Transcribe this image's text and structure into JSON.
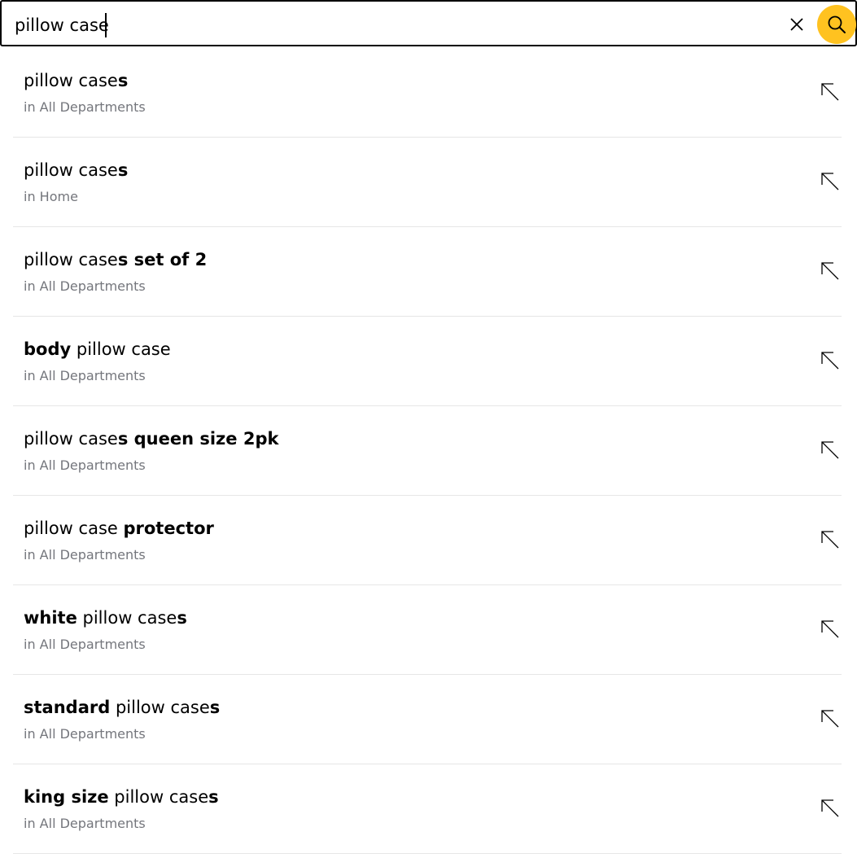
{
  "search": {
    "value": "pillow case",
    "clear_icon": "close-icon",
    "submit_icon": "search-icon",
    "accent_color": "#ffc220"
  },
  "suggestions": [
    {
      "parts": [
        {
          "text": "pillow case",
          "bold": false
        },
        {
          "text": "s",
          "bold": true
        }
      ],
      "department": "in All Departments"
    },
    {
      "parts": [
        {
          "text": "pillow case",
          "bold": false
        },
        {
          "text": "s",
          "bold": true
        }
      ],
      "department": "in Home"
    },
    {
      "parts": [
        {
          "text": "pillow case",
          "bold": false
        },
        {
          "text": "s set of 2",
          "bold": true
        }
      ],
      "department": "in All Departments"
    },
    {
      "parts": [
        {
          "text": "body",
          "bold": true
        },
        {
          "text": " pillow case",
          "bold": false
        }
      ],
      "department": "in All Departments"
    },
    {
      "parts": [
        {
          "text": "pillow case",
          "bold": false
        },
        {
          "text": "s queen size 2pk",
          "bold": true
        }
      ],
      "department": "in All Departments"
    },
    {
      "parts": [
        {
          "text": "pillow case ",
          "bold": false
        },
        {
          "text": "protector",
          "bold": true
        }
      ],
      "department": "in All Departments"
    },
    {
      "parts": [
        {
          "text": "white",
          "bold": true
        },
        {
          "text": " pillow case",
          "bold": false
        },
        {
          "text": "s",
          "bold": true
        }
      ],
      "department": "in All Departments"
    },
    {
      "parts": [
        {
          "text": "standard",
          "bold": true
        },
        {
          "text": " pillow case",
          "bold": false
        },
        {
          "text": "s",
          "bold": true
        }
      ],
      "department": "in All Departments"
    },
    {
      "parts": [
        {
          "text": "king size",
          "bold": true
        },
        {
          "text": " pillow case",
          "bold": false
        },
        {
          "text": "s",
          "bold": true
        }
      ],
      "department": "in All Departments"
    }
  ],
  "suggestion_fill_icon": "arrow-up-left-icon"
}
